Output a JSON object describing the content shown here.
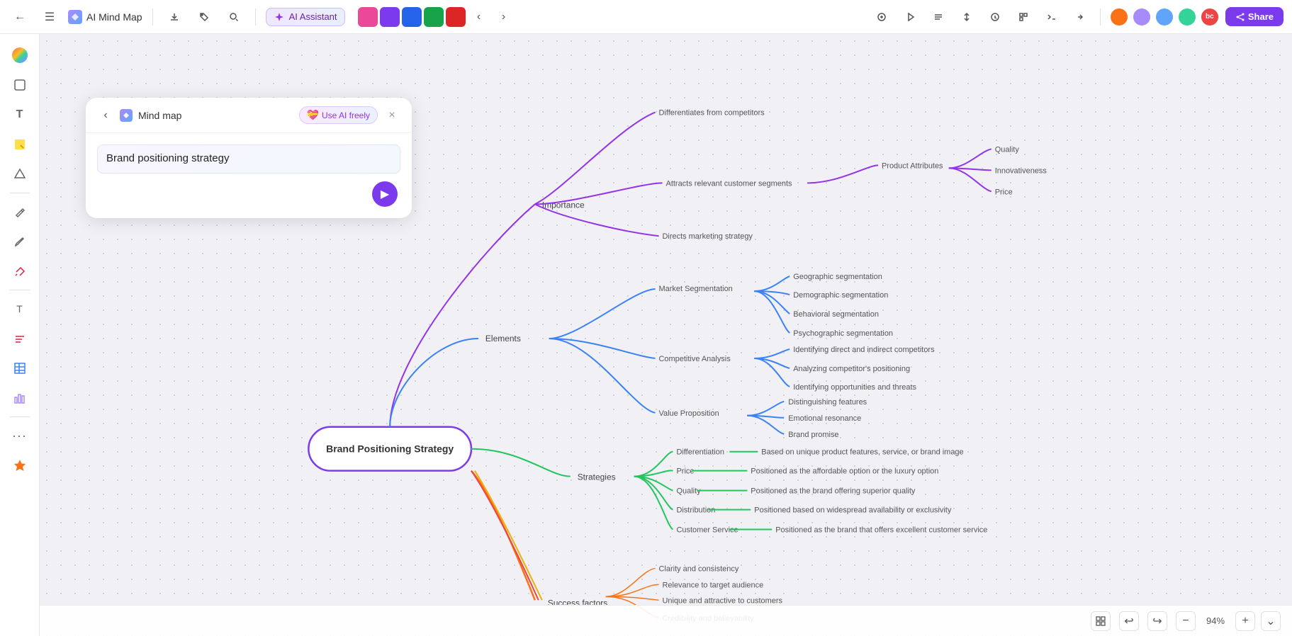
{
  "toolbar": {
    "back_icon": "←",
    "menu_icon": "☰",
    "cloud_icon": "☁",
    "app_title": "AI Mind Map",
    "download_icon": "⬇",
    "tag_icon": "🏷",
    "search_icon": "🔍",
    "ai_assistant_label": "AI Assistant",
    "chevron_left": "‹",
    "chevron_right": "›",
    "share_label": "Share",
    "zoom_level": "94%"
  },
  "panel": {
    "title": "Mind map",
    "ai_freely_label": "Use AI freely",
    "close_icon": "×",
    "content_text": "Brand positioning strategy",
    "send_icon": "▶",
    "back_icon": "‹"
  },
  "mindmap": {
    "center_node": "Brand Positioning Strategy",
    "branches": [
      {
        "id": "importance",
        "label": "Importance",
        "color": "#9333ea",
        "children": [
          {
            "label": "Differentiates from competitors",
            "children": []
          },
          {
            "label": "Attracts relevant customer segments",
            "children": [
              {
                "label": "Product Attributes",
                "children": [
                  {
                    "label": "Quality"
                  },
                  {
                    "label": "Innovativeness"
                  },
                  {
                    "label": "Price"
                  }
                ]
              }
            ]
          },
          {
            "label": "Directs marketing strategy",
            "children": []
          }
        ]
      },
      {
        "id": "elements",
        "label": "Elements",
        "color": "#3b82f6",
        "children": [
          {
            "label": "Market Segmentation",
            "children": [
              {
                "label": "Geographic segmentation"
              },
              {
                "label": "Demographic segmentation"
              },
              {
                "label": "Behavioral segmentation"
              },
              {
                "label": "Psychographic segmentation"
              }
            ]
          },
          {
            "label": "Competitive Analysis",
            "children": [
              {
                "label": "Identifying direct and indirect competitors"
              },
              {
                "label": "Analyzing competitor's positioning"
              },
              {
                "label": "Identifying opportunities and threats"
              }
            ]
          },
          {
            "label": "Value Proposition",
            "children": [
              {
                "label": "Distinguishing features"
              },
              {
                "label": "Emotional resonance"
              },
              {
                "label": "Brand promise"
              }
            ]
          }
        ]
      },
      {
        "id": "strategies",
        "label": "Strategies",
        "color": "#22c55e",
        "children": [
          {
            "label": "Differentiation",
            "detail": "Based on unique product features, service, or brand image"
          },
          {
            "label": "Price",
            "detail": "Positioned as the affordable option or the luxury option"
          },
          {
            "label": "Quality",
            "detail": "Positioned as the brand offering superior quality"
          },
          {
            "label": "Distribution",
            "detail": "Positioned based on widespread availability or exclusivity"
          },
          {
            "label": "Customer Service",
            "detail": "Positioned as the brand that offers excellent customer service"
          }
        ]
      },
      {
        "id": "success_factors",
        "label": "Success factors",
        "color": "#f97316",
        "children": [
          {
            "label": "Clarity and consistency"
          },
          {
            "label": "Relevance to target audience"
          },
          {
            "label": "Unique and attractive to customers"
          },
          {
            "label": "Credibility and believability"
          }
        ]
      }
    ]
  },
  "bottom_bar": {
    "undo_icon": "↩",
    "redo_icon": "↪",
    "zoom_out_icon": "−",
    "zoom_level": "94%",
    "zoom_in_icon": "+",
    "chevron_down": "∨",
    "layout_icon": "⊞"
  },
  "sidebar": {
    "icons": [
      {
        "name": "palette",
        "symbol": "🎨",
        "active": false
      },
      {
        "name": "frame",
        "symbol": "⬜",
        "active": false
      },
      {
        "name": "text",
        "symbol": "T",
        "active": false
      },
      {
        "name": "sticky",
        "symbol": "🟡",
        "active": false
      },
      {
        "name": "shapes",
        "symbol": "⬡",
        "active": false
      },
      {
        "name": "pen",
        "symbol": "✒",
        "active": false
      },
      {
        "name": "brush",
        "symbol": "🖌",
        "active": false
      },
      {
        "name": "eraser",
        "symbol": "⚡",
        "active": false
      },
      {
        "name": "text2",
        "symbol": "T",
        "active": false
      },
      {
        "name": "list",
        "symbol": "≡",
        "active": false
      },
      {
        "name": "table",
        "symbol": "⊞",
        "active": false
      },
      {
        "name": "chart",
        "symbol": "📊",
        "active": false
      },
      {
        "name": "brand",
        "symbol": "✦",
        "active": false
      }
    ]
  },
  "user_avatars": [
    {
      "color": "#f97316",
      "initials": ""
    },
    {
      "color": "#a78bfa",
      "initials": ""
    },
    {
      "color": "#60a5fa",
      "initials": ""
    },
    {
      "color": "#34d399",
      "initials": ""
    },
    {
      "color": "#f87171",
      "initials": "bc"
    }
  ]
}
